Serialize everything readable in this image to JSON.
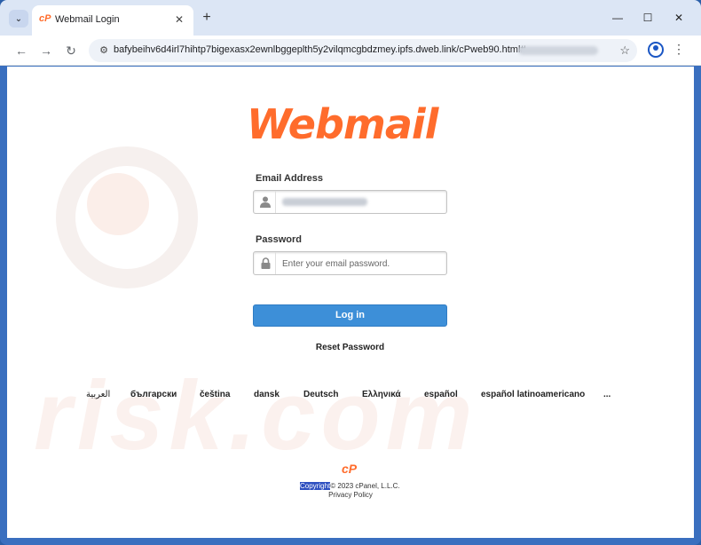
{
  "browser": {
    "tab_title": "Webmail Login",
    "tab_favicon": "cP",
    "url": "bafybeihv6d4irl7hihtp7bigexasx2ewnlbggeplth5y2vilqmcgbdzmey.ipfs.dweb.link/cPweb90.html#",
    "new_tab_glyph": "+",
    "close_tab_glyph": "✕",
    "minimize_glyph": "—",
    "maximize_glyph": "☐",
    "close_window_glyph": "✕",
    "back_glyph": "←",
    "forward_glyph": "→",
    "reload_glyph": "↻",
    "star_glyph": "☆",
    "menu_glyph": "⋮",
    "tab_search_glyph": "⌄"
  },
  "page": {
    "logo_text": "Webmail",
    "email_label": "Email Address",
    "password_label": "Password",
    "password_placeholder": "Enter your email password.",
    "login_button": "Log in",
    "reset_password": "Reset Password",
    "languages": [
      "العربية",
      "български",
      "čeština",
      "dansk",
      "Deutsch",
      "Ελληνικά",
      "español",
      "español latinoamericano",
      "..."
    ],
    "footer_logo": "cP",
    "copyright_highlighted": "Copyright",
    "copyright_rest": "© 2023 cPanel, L.L.C.",
    "privacy_policy": "Privacy Policy"
  },
  "icons": {
    "email_field_icon": "user-icon",
    "password_field_icon": "lock-icon"
  },
  "colors": {
    "brand_orange": "#ff6c2c",
    "login_blue": "#3d8fd8",
    "browser_frame": "#3a6fbf"
  },
  "watermark": "risk.com"
}
